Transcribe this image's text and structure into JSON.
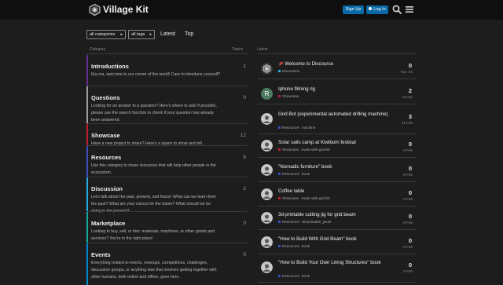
{
  "site": {
    "title": "Village Kit",
    "accent": "#0a6aa8"
  },
  "header": {
    "signup_label": "Sign Up",
    "login_label": "Log In",
    "icons": [
      "search-icon",
      "hamburger-menu-icon"
    ]
  },
  "nav": {
    "categories_label": "all categories",
    "tags_label": "all tags",
    "latest_label": "Latest",
    "top_label": "Top"
  },
  "columns": {
    "category": "Category",
    "topics": "Topics",
    "latest": "Latest"
  },
  "categories": [
    {
      "name": "Introductions",
      "color": "#652d90",
      "count": "1",
      "desc": "Kia ora, welcome to our corner of the world! Care to introduce yourself?"
    },
    {
      "name": "Questions",
      "color": "#9e9e9e",
      "count": "0",
      "desc": "Looking for an answer to a question? Here's where to ask! If possible, please use the search function to check if your question has already been answered."
    },
    {
      "name": "Showcase",
      "color": "#bf1e2e",
      "count": "12",
      "desc": "Have a new project to share? Here's a space to show and tell."
    },
    {
      "name": "Resources",
      "color": "#3a4fbf",
      "count": "6",
      "desc": "Use this category to share resources that will help other people in the ecosystem."
    },
    {
      "name": "Discussion",
      "color": "#25aae1",
      "count": "2",
      "desc": "Let's talk about the past, present, and future! What can we learn from the past? What are your visions for the future? What should we be doing in the present?"
    },
    {
      "name": "Marketplace",
      "color": "#12a89d",
      "count": "0",
      "desc": "Looking to buy, sell, or hire: materials, machines, or other goods and services? You're in the right place!"
    },
    {
      "name": "Events",
      "color": "#0088cc",
      "count": "0",
      "desc": "Everything related to events, meetups, competitions, challenges, discussion groups, or anything else that involves getting together with other humans, both online and offline, goes here."
    }
  ],
  "topics": [
    {
      "title": "Welcome to Discourse",
      "pinned": true,
      "category": "Discussion",
      "cat_color": "#25aae1",
      "tags": [],
      "count": "0",
      "date": "Nov '21",
      "avatar": "logo"
    },
    {
      "title": "Iphone filming rig",
      "category": "Showcase",
      "cat_color": "#bf1e2e",
      "tags": [],
      "count": "2",
      "date": "19 Apr",
      "avatar": "R"
    },
    {
      "title": "Grid Bot (experimental automated drilling machine)",
      "category": "Resources",
      "cat_color": "#3a4fbf",
      "tags": [
        "machine"
      ],
      "count": "3",
      "date": "11 Feb",
      "avatar": "person"
    },
    {
      "title": "Solar sails camp at Kiwiburn festival",
      "category": "Showcase",
      "cat_color": "#bf1e2e",
      "tags": [
        "made-with-grid-kit"
      ],
      "count": "0",
      "date": "9 Feb",
      "avatar": "person"
    },
    {
      "title": "\"Nomadic furniture\" book",
      "category": "Resources",
      "cat_color": "#3a4fbf",
      "tags": [
        "book"
      ],
      "count": "0",
      "date": "8 Feb",
      "avatar": "person"
    },
    {
      "title": "Coffee table",
      "category": "Showcase",
      "cat_color": "#bf1e2e",
      "tags": [
        "made-with-grid-kit"
      ],
      "count": "0",
      "date": "8 Feb",
      "avatar": "person"
    },
    {
      "title": "3d-printable cutting jig for grid beam",
      "category": "Resources",
      "cat_color": "#3a4fbf",
      "tags": [
        "3d-printable_jwoel"
      ],
      "count": "0",
      "date": "8 Feb",
      "avatar": "person"
    },
    {
      "title": "\"How to Build With Grid Beam\" book",
      "category": "Resources",
      "cat_color": "#3a4fbf",
      "tags": [
        "book"
      ],
      "count": "0",
      "date": "8 Feb",
      "avatar": "person"
    },
    {
      "title": "\"How to Build Your Own Living Structures\" book",
      "category": "Resources",
      "cat_color": "#3a4fbf",
      "tags": [
        "book"
      ],
      "count": "0",
      "date": "8 Feb",
      "avatar": "person"
    }
  ]
}
